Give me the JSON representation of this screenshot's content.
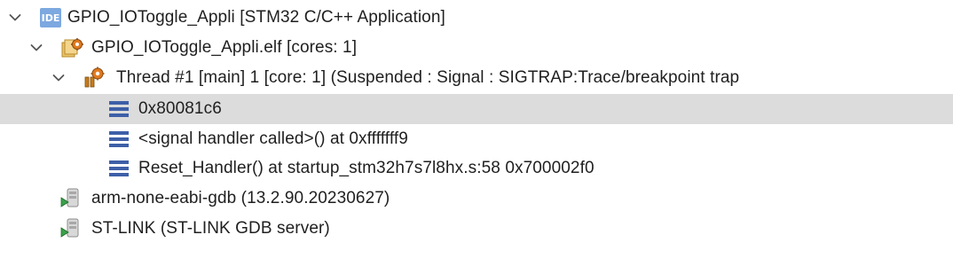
{
  "tree": {
    "rows": [
      {
        "label": "GPIO_IOToggle_Appli [STM32 C/C++ Application]",
        "icon": "ide-launch-config-icon",
        "badge": "IDE",
        "expanded": true
      },
      {
        "label": "GPIO_IOToggle_Appli.elf [cores: 1]",
        "icon": "elf-process-icon",
        "expanded": true
      },
      {
        "label": "Thread #1 [main] 1 [core: 1] (Suspended : Signal : SIGTRAP:Trace/breakpoint trap",
        "icon": "thread-suspended-icon",
        "expanded": true
      },
      {
        "label": "0x80081c6",
        "icon": "stack-frame-icon",
        "selected": true
      },
      {
        "label": "<signal handler called>() at 0xfffffff9",
        "icon": "stack-frame-icon"
      },
      {
        "label": "Reset_Handler() at startup_stm32h7s7l8hx.s:58 0x700002f0",
        "icon": "stack-frame-icon"
      },
      {
        "label": "arm-none-eabi-gdb (13.2.90.20230627)",
        "icon": "debugger-process-icon"
      },
      {
        "label": "ST-LINK (ST-LINK GDB server)",
        "icon": "debugger-process-icon"
      }
    ]
  }
}
